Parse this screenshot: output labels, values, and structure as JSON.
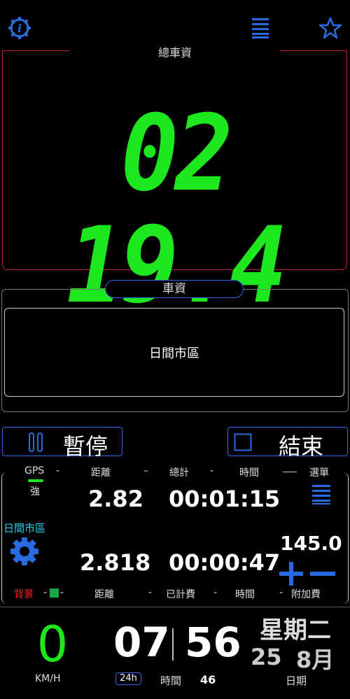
{
  "top_bar": {
    "info_icon": "info-gear-icon",
    "menu_icon": "hamburger-icon",
    "star_icon": "star-icon"
  },
  "fare": {
    "title": "總車資",
    "amount": "02 19.4"
  },
  "rate": {
    "tab_label": "車資",
    "rate_name": "日間市區"
  },
  "controls": {
    "pause_label": "暫停",
    "end_label": "結束"
  },
  "stats": {
    "header": {
      "gps": "GPS",
      "gps_strength": "強",
      "distance": "距離",
      "total": "總計",
      "time": "時間",
      "menu": "選單"
    },
    "row1": {
      "distance": "2.82",
      "total_time": "00:01:15"
    },
    "rate_mode": "日間市區",
    "surcharge_value": "145.0",
    "row2": {
      "distance": "2.818",
      "charged_time": "00:00:47"
    },
    "footer": {
      "background": "背景",
      "distance": "距離",
      "charged": "已計費",
      "time": "時間",
      "surcharge": "附加費"
    }
  },
  "bottom": {
    "speed": "0",
    "speed_unit": "KM/H",
    "hour": "07",
    "minute": "56",
    "format": "24h",
    "time_label": "時間",
    "seconds": "46",
    "weekday": "星期二",
    "day": "25",
    "month": "8月",
    "date_label": "日期"
  },
  "colors": {
    "digit_green": "#1de81d",
    "accent_blue": "#2a6ae0",
    "frame_red": "#c0202a",
    "mode_cyan": "#2ad0f0",
    "bg_red": "#ff2020"
  }
}
